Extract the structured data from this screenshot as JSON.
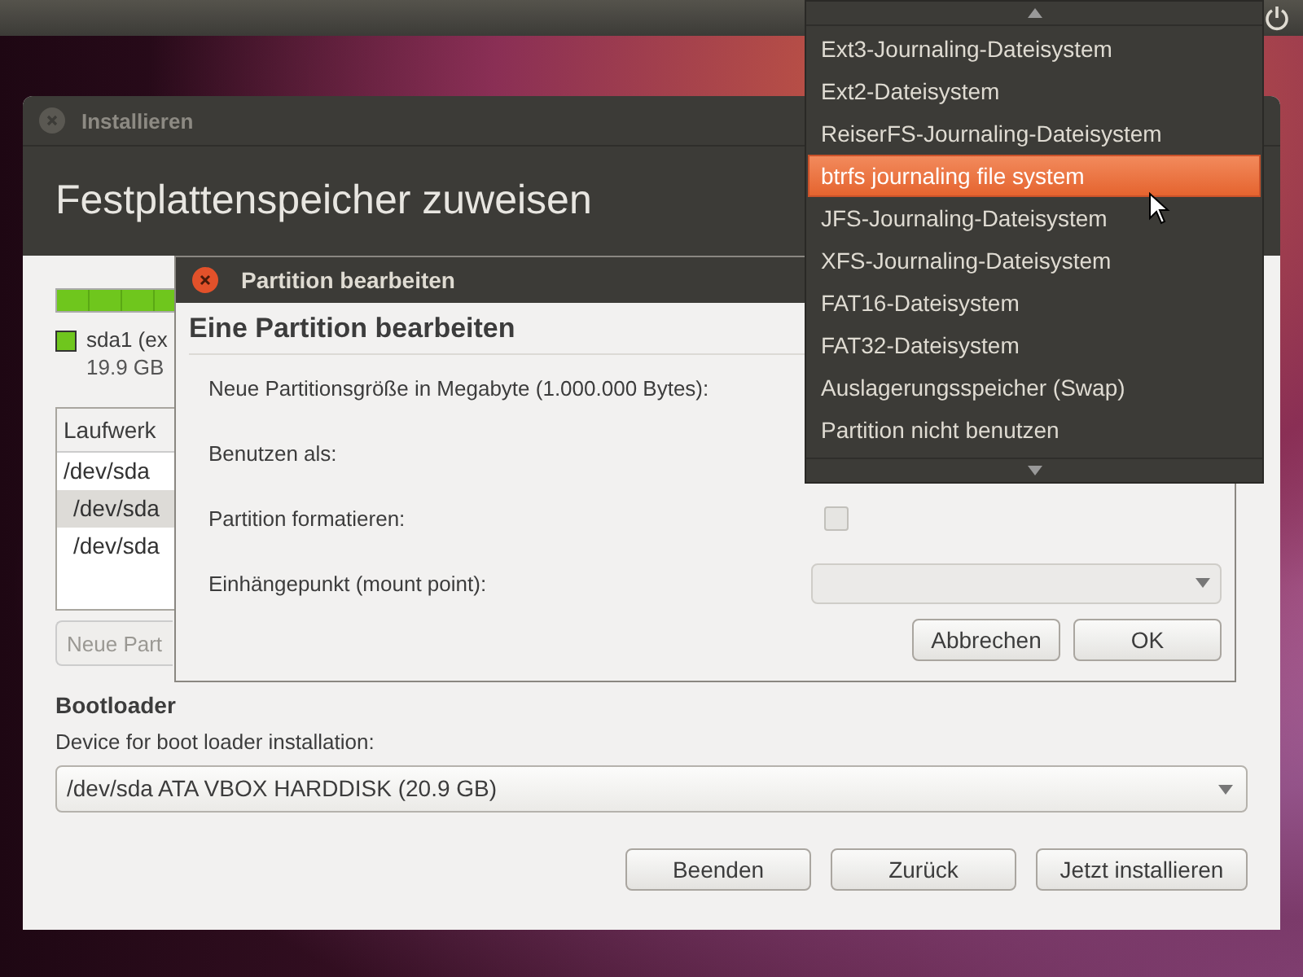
{
  "installer": {
    "title": "Installieren",
    "heading": "Festplattenspeicher zuweisen",
    "partitions": [
      {
        "label": "sda1 (ex",
        "size": "19.9 GB",
        "color": "#6fc61d",
        "level": 0.96
      }
    ],
    "table": {
      "columns": [
        "Laufwerk"
      ],
      "rows": [
        {
          "cells": [
            "/dev/sda"
          ],
          "selected": false,
          "children": [
            {
              "cells": [
                "/dev/sda"
              ],
              "selected": true
            },
            {
              "cells": [
                "/dev/sda"
              ],
              "selected": false
            }
          ]
        }
      ]
    },
    "new_partition_button": {
      "label": "Neue Part",
      "disabled": true
    },
    "bootloader": {
      "heading": "Bootloader",
      "label": "Device for boot loader installation:",
      "value": "/dev/sda ATA VBOX HARDDISK (20.9 GB)"
    },
    "buttons": [
      "Beenden",
      "Zurück",
      "Jetzt installieren"
    ]
  },
  "dialog": {
    "title": "Partition bearbeiten",
    "heading": "Eine Partition bearbeiten",
    "fields": [
      {
        "label": "Neue Partitionsgröße in Megabyte (1.000.000 Bytes):",
        "kind": "label"
      },
      {
        "label": "Benutzen als:",
        "kind": "label"
      },
      {
        "label": "Partition formatieren:",
        "kind": "checkbox",
        "checked": false,
        "disabled": true
      },
      {
        "label": "Einhängepunkt (mount point):",
        "kind": "combo",
        "disabled": true
      }
    ],
    "buttons": [
      "Abbrechen",
      "OK"
    ]
  },
  "menu": {
    "items": [
      {
        "label": "Ext3-Journaling-Dateisystem",
        "selected": false
      },
      {
        "label": "Ext2-Dateisystem",
        "selected": false
      },
      {
        "label": "ReiserFS-Journaling-Dateisystem",
        "selected": false
      },
      {
        "label": "btrfs journaling file system",
        "selected": true
      },
      {
        "label": "JFS-Journaling-Dateisystem",
        "selected": false
      },
      {
        "label": "XFS-Journaling-Dateisystem",
        "selected": false
      },
      {
        "label": "FAT16-Dateisystem",
        "selected": false
      },
      {
        "label": "FAT32-Dateisystem",
        "selected": false
      },
      {
        "label": "Auslagerungsspeicher (Swap)",
        "selected": false
      },
      {
        "label": "Partition nicht benutzen",
        "selected": false
      }
    ]
  }
}
